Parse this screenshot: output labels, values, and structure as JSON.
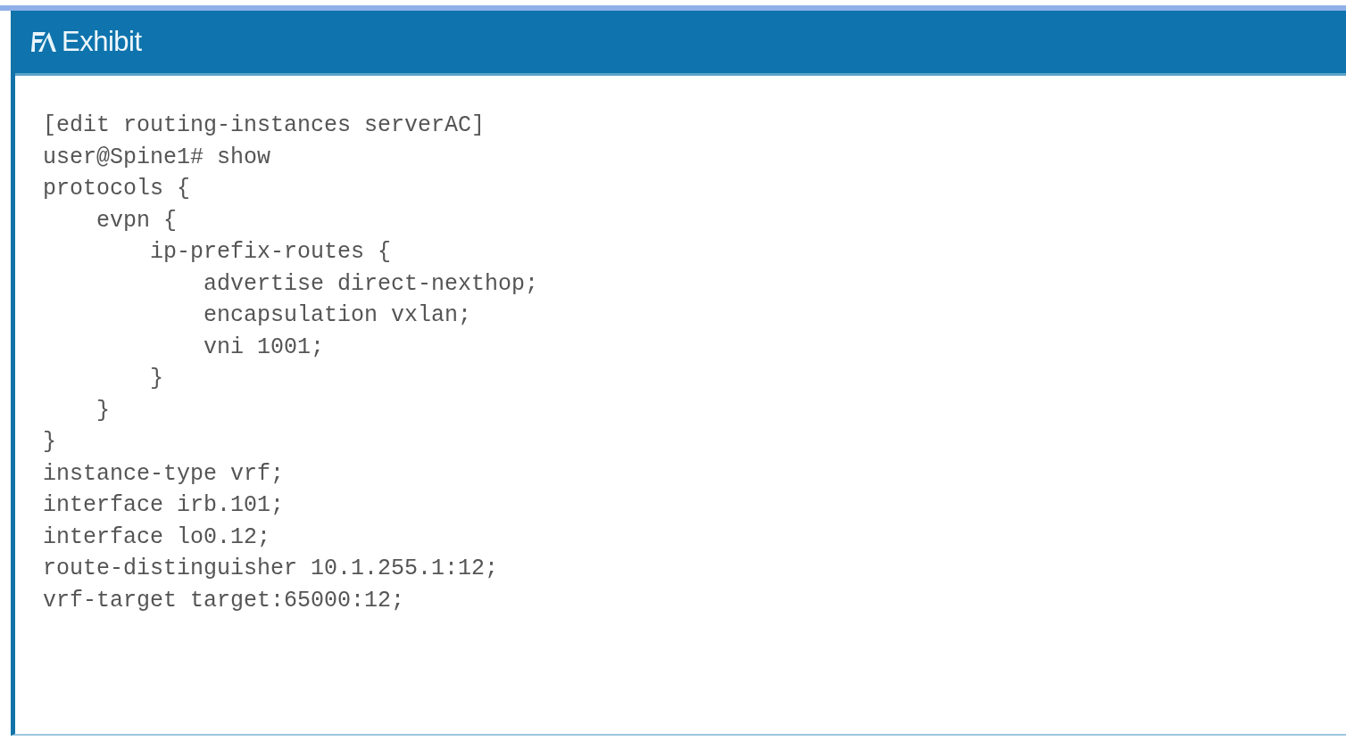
{
  "window": {
    "title": "Exhibit"
  },
  "code_lines": [
    "[edit routing-instances serverAC]",
    "user@Spine1# show",
    "protocols {",
    "    evpn {",
    "        ip-prefix-routes {",
    "            advertise direct-nexthop;",
    "            encapsulation vxlan;",
    "            vni 1001;",
    "        }",
    "    }",
    "}",
    "instance-type vrf;",
    "interface irb.101;",
    "interface lo0.12;",
    "route-distinguisher 10.1.255.1:12;",
    "vrf-target target:65000:12;"
  ]
}
